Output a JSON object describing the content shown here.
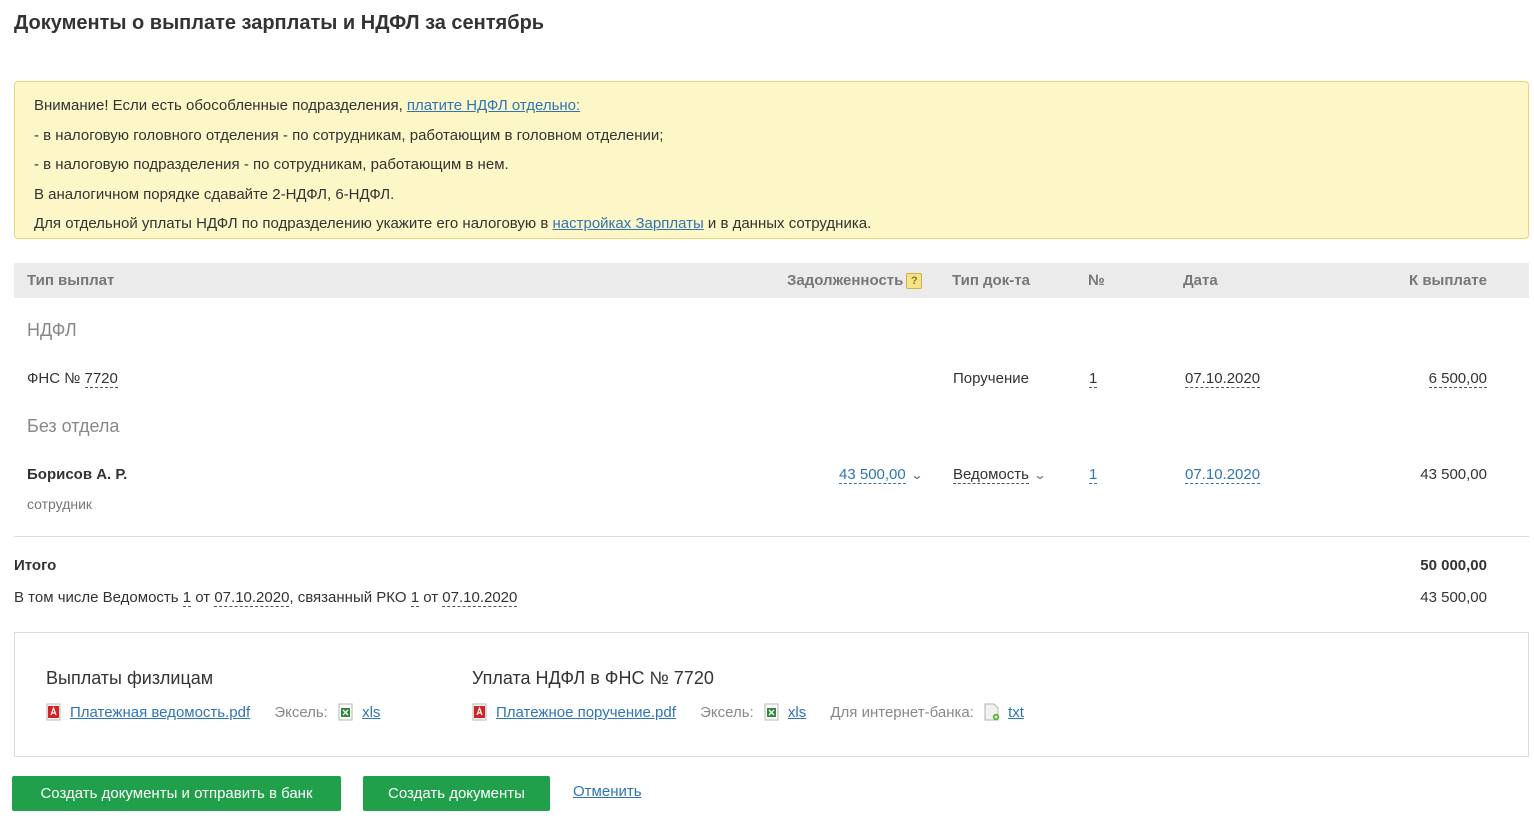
{
  "page_title": "Документы о выплате зарплаты и НДФЛ за сентябрь",
  "notice": {
    "line1_text": "Внимание! Если есть обособленные подразделения, ",
    "line1_link": "платите НДФЛ отдельно:",
    "line2": "- в налоговую головного отделения - по сотрудникам, работающим в головном отделении;",
    "line3": "- в налоговую подразделения - по сотрудникам, работающим в нем.",
    "line4": "В аналогичном порядке сдавайте 2-НДФЛ, 6-НДФЛ.",
    "line5_before": "Для отдельной уплаты НДФЛ по подразделению укажите его налоговую в ",
    "line5_link": "настройках Зарплаты",
    "line5_after": " и в данных сотрудника."
  },
  "table": {
    "headers": {
      "type": "Тип выплат",
      "debt": "Задолженность",
      "debt_help": "?",
      "doc_type": "Тип док-та",
      "number": "№",
      "date": "Дата",
      "to_pay": "К выплате"
    },
    "group_ndfl": "НДФЛ",
    "fns_row": {
      "name_prefix": "ФНС № ",
      "name_number": "7720",
      "doc_type": "Поручение",
      "number": "1",
      "date": "07.10.2020",
      "amount": "6 500,00"
    },
    "group_dept": "Без отдела",
    "employee_row": {
      "name": "Борисов А. Р.",
      "role": "сотрудник",
      "debt": "43 500,00",
      "doc_type": "Ведомость",
      "number": "1",
      "date": "07.10.2020",
      "amount": "43 500,00"
    }
  },
  "totals": {
    "label": "Итого",
    "amount": "50 000,00",
    "detail_1": "В том числе Ведомость ",
    "detail_num1": "1",
    "detail_2": " от ",
    "detail_date1": "07.10.2020",
    "detail_3": ", связанный РКО ",
    "detail_num2": "1",
    "detail_4": " от ",
    "detail_date2": "07.10.2020",
    "detail_amount": "43 500,00"
  },
  "downloads": {
    "left": {
      "title": "Выплаты физлицам",
      "pdf": "Платежная ведомость.pdf",
      "excel_label": "Эксель:",
      "xls": "xls"
    },
    "right": {
      "title": "Уплата НДФЛ в ФНС № 7720",
      "pdf": "Платежное поручение.pdf",
      "excel_label": "Эксель:",
      "xls": "xls",
      "bank_label": "Для интернет-банка:",
      "txt": "txt"
    }
  },
  "actions": {
    "create_send": "Создать документы и отправить в банк",
    "create": "Создать документы",
    "cancel": "Отменить"
  },
  "colors": {
    "primary_button": "#21a04b",
    "link": "#2f75b5",
    "notice_bg": "#fdf6c6",
    "header_bg": "#ebebeb"
  }
}
